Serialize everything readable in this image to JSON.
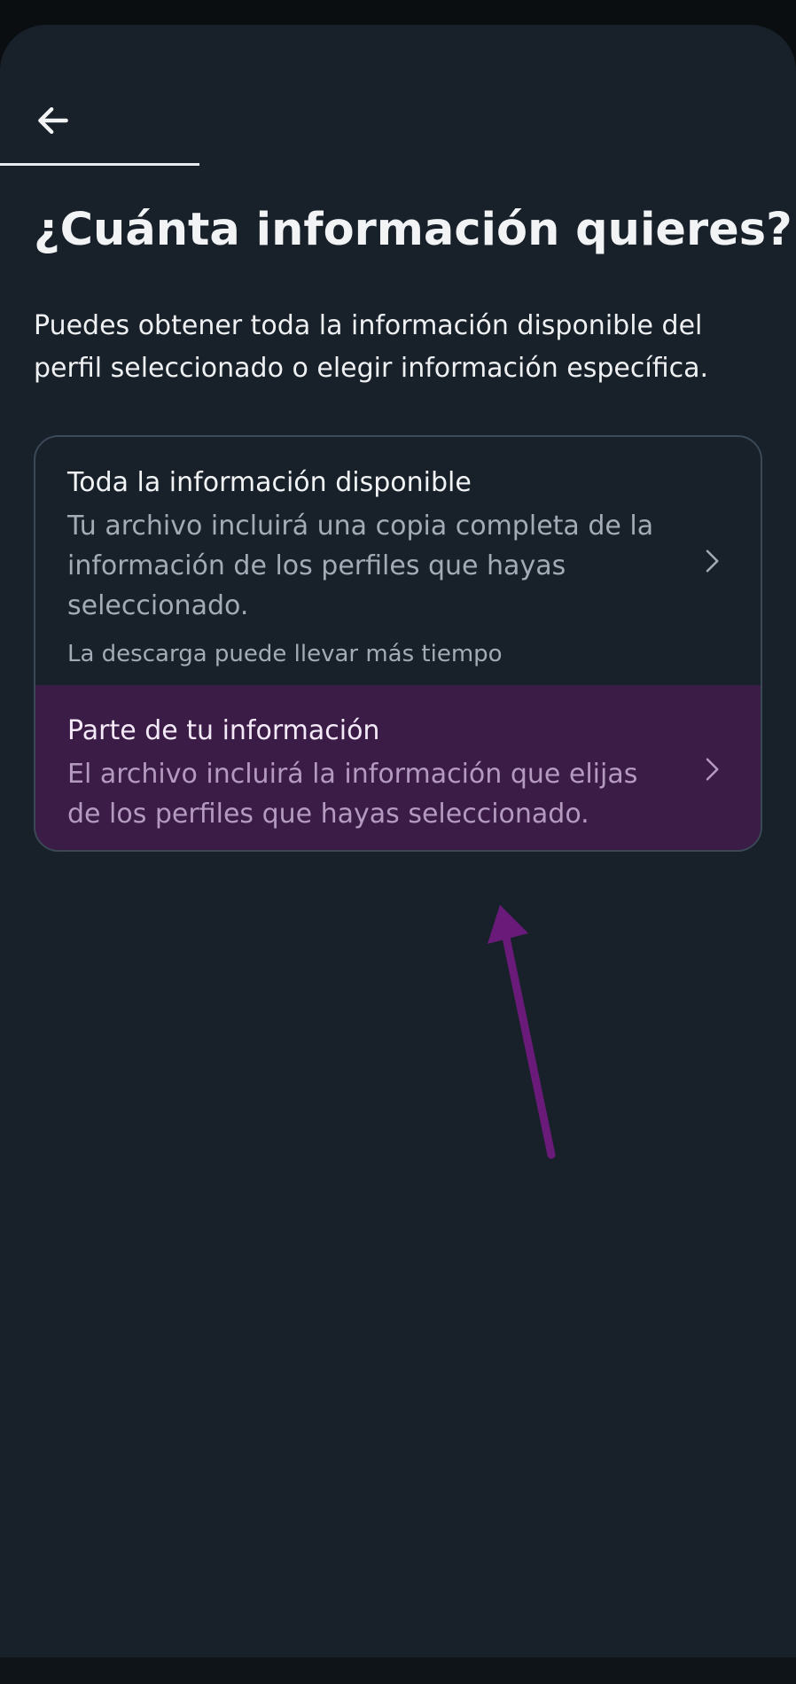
{
  "header": {
    "back_icon": "arrow-left-icon",
    "progress_fraction": 0.25
  },
  "page": {
    "title": "¿Cuánta información quieres?",
    "subtitle": "Puedes obtener toda la información disponible del perfil seleccionado o elegir información específica."
  },
  "options": [
    {
      "title": "Toda la información disponible",
      "description": "Tu archivo incluirá una copia completa de la información de los perfiles que hayas seleccionado.",
      "note": "La descarga puede llevar más tiempo",
      "icon": "chevron-right-icon"
    },
    {
      "title": "Parte de tu información",
      "description": "El archivo incluirá la información que elijas de los perfiles que hayas seleccionado.",
      "icon": "chevron-right-icon",
      "highlighted": true
    }
  ],
  "colors": {
    "background": "#18212a",
    "highlight": "#3b1c47",
    "annotation_arrow": "#6a1b7a"
  }
}
